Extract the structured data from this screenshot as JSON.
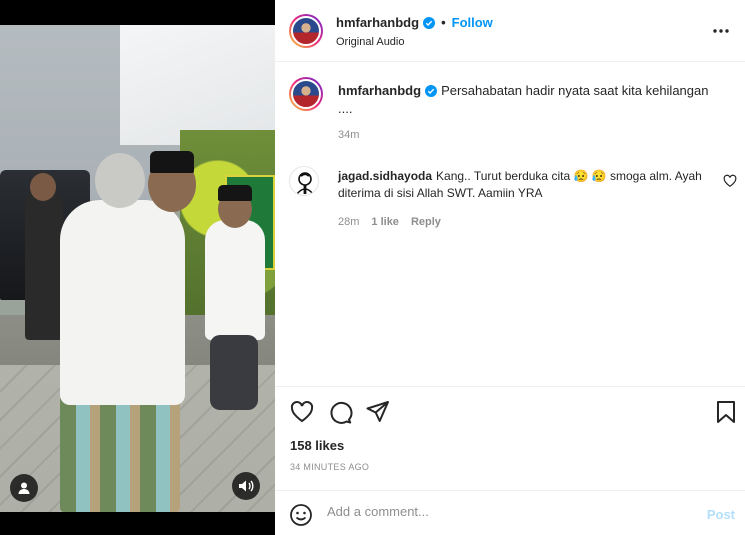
{
  "post": {
    "author": "hmfarhanbdg",
    "follow_label": "Follow",
    "dot": "•",
    "audio": "Original Audio",
    "caption": "Persahabatan hadir nyata saat kita kehilangan ....",
    "caption_time": "34m",
    "likes": "158 likes",
    "posted_ago": "34 MINUTES AGO"
  },
  "comments": [
    {
      "username": "jagad.sidhayoda",
      "text": "Kang.. Turut berduka cita 😥 😥 smoga alm. Ayah diterima di sisi Allah SWT. Aamiin YRA",
      "time": "28m",
      "likes": "1 like",
      "reply_label": "Reply"
    }
  ],
  "composer": {
    "placeholder": "Add a comment...",
    "post_label": "Post"
  },
  "icons": {
    "verified": "verified-badge-icon",
    "more": "more-options-icon",
    "like": "heart-icon",
    "comment": "comment-bubble-icon",
    "share": "paper-plane-icon",
    "save": "bookmark-icon",
    "emoji": "emoji-smiley-icon",
    "media_user": "user-tag-icon",
    "media_sound": "sound-icon"
  },
  "colors": {
    "accent": "#0095f6",
    "post_disabled": "#b2dffc",
    "muted": "#8e8e8e"
  }
}
